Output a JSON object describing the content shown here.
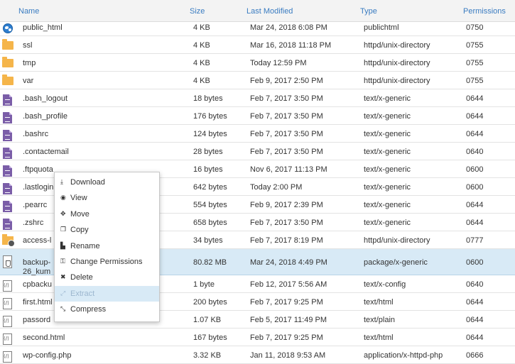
{
  "columns": {
    "name": "Name",
    "size": "Size",
    "modified": "Last Modified",
    "type": "Type",
    "permissions": "Permissions"
  },
  "files": [
    {
      "name": "public_html",
      "size": "4 KB",
      "modified": "Mar 24, 2018 6:08 PM",
      "type": "publichtml",
      "perm": "0750",
      "icon": "globe-icon"
    },
    {
      "name": "ssl",
      "size": "4 KB",
      "modified": "Mar 16, 2018 11:18 PM",
      "type": "httpd/unix-directory",
      "perm": "0755",
      "icon": "folder-icon"
    },
    {
      "name": "tmp",
      "size": "4 KB",
      "modified": "Today 12:59 PM",
      "type": "httpd/unix-directory",
      "perm": "0755",
      "icon": "folder-icon"
    },
    {
      "name": "var",
      "size": "4 KB",
      "modified": "Feb 9, 2017 2:50 PM",
      "type": "httpd/unix-directory",
      "perm": "0755",
      "icon": "folder-icon"
    },
    {
      "name": ".bash_logout",
      "size": "18 bytes",
      "modified": "Feb 7, 2017 3:50 PM",
      "type": "text/x-generic",
      "perm": "0644",
      "icon": "document-icon"
    },
    {
      "name": ".bash_profile",
      "size": "176 bytes",
      "modified": "Feb 7, 2017 3:50 PM",
      "type": "text/x-generic",
      "perm": "0644",
      "icon": "document-icon"
    },
    {
      "name": ".bashrc",
      "size": "124 bytes",
      "modified": "Feb 7, 2017 3:50 PM",
      "type": "text/x-generic",
      "perm": "0644",
      "icon": "document-icon"
    },
    {
      "name": ".contactemail",
      "size": "28 bytes",
      "modified": "Feb 7, 2017 3:50 PM",
      "type": "text/x-generic",
      "perm": "0640",
      "icon": "document-icon"
    },
    {
      "name": ".ftpquota",
      "size": "16 bytes",
      "modified": "Nov 6, 2017 11:13 PM",
      "type": "text/x-generic",
      "perm": "0600",
      "icon": "document-icon"
    },
    {
      "name": ".lastlogin",
      "size": "642 bytes",
      "modified": "Today 2:00 PM",
      "type": "text/x-generic",
      "perm": "0600",
      "icon": "document-icon"
    },
    {
      "name": ".pearrc",
      "size": "554 bytes",
      "modified": "Feb 9, 2017 2:39 PM",
      "type": "text/x-generic",
      "perm": "0644",
      "icon": "document-icon"
    },
    {
      "name": ".zshrc",
      "size": "658 bytes",
      "modified": "Feb 7, 2017 3:50 PM",
      "type": "text/x-generic",
      "perm": "0644",
      "icon": "document-icon"
    },
    {
      "name": "access-l",
      "size": "34 bytes",
      "modified": "Feb 7, 2017 8:19 PM",
      "type": "httpd/unix-directory",
      "perm": "0777",
      "icon": "folder-link-icon"
    },
    {
      "name": "backup-\n26_kum",
      "size": "80.82 MB",
      "modified": "Mar 24, 2018 4:49 PM",
      "type": "package/x-generic",
      "perm": "0600",
      "icon": "package-icon",
      "selected": true
    },
    {
      "name": "cpbacku",
      "size": "1 byte",
      "modified": "Feb 12, 2017 5:56 AM",
      "type": "text/x-config",
      "perm": "0640",
      "icon": "code-file-icon"
    },
    {
      "name": "first.html",
      "size": "200 bytes",
      "modified": "Feb 7, 2017 9:25 PM",
      "type": "text/html",
      "perm": "0644",
      "icon": "code-file-icon"
    },
    {
      "name": "passord",
      "size": "1.07 KB",
      "modified": "Feb 5, 2017 11:49 PM",
      "type": "text/plain",
      "perm": "0644",
      "icon": "code-file-icon"
    },
    {
      "name": "second.html",
      "size": "167 bytes",
      "modified": "Feb 7, 2017 9:25 PM",
      "type": "text/html",
      "perm": "0644",
      "icon": "code-file-icon"
    },
    {
      "name": "wp-config.php",
      "size": "3.32 KB",
      "modified": "Jan 11, 2018 9:53 AM",
      "type": "application/x-httpd-php",
      "perm": "0666",
      "icon": "code-file-icon"
    }
  ],
  "context_menu": [
    {
      "label": "Download",
      "icon": "download-icon",
      "glyph": "⤓"
    },
    {
      "label": "View",
      "icon": "eye-icon",
      "glyph": "◉"
    },
    {
      "label": "Move",
      "icon": "move-icon",
      "glyph": "✥"
    },
    {
      "label": "Copy",
      "icon": "copy-icon",
      "glyph": "❐"
    },
    {
      "label": "Rename",
      "icon": "rename-icon",
      "glyph": "▙"
    },
    {
      "label": "Change Permissions",
      "icon": "key-icon",
      "glyph": "⚿"
    },
    {
      "label": "Delete",
      "icon": "delete-icon",
      "glyph": "✖"
    },
    {
      "label": "Extract",
      "icon": "extract-icon",
      "glyph": "⤢",
      "highlighted": true
    },
    {
      "label": "Compress",
      "icon": "compress-icon",
      "glyph": "⤡"
    }
  ]
}
